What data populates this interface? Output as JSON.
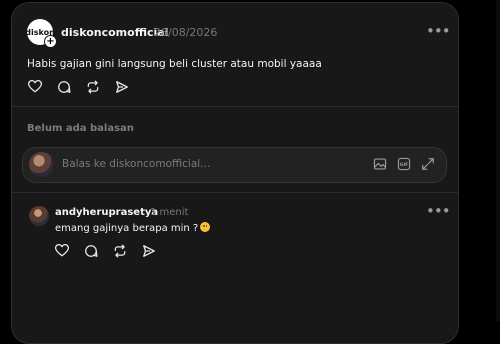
{
  "post": {
    "avatar_text": "diskon",
    "username": "diskoncomofficial",
    "timestamp": "28/08/2026",
    "text": "Habis gajian gini langsung beli cluster atau mobil yaaaa",
    "more_label": "•••"
  },
  "replies_section": {
    "empty_text": "Belum ada balasan"
  },
  "reply_input": {
    "placeholder": "Balas ke diskoncomofficial…"
  },
  "comment": {
    "username": "andyheruprasetya",
    "timestamp": "1 menit",
    "text": "emang gajinya berapa min ?",
    "more_label": "•••"
  },
  "icons": [
    "heart-icon",
    "comment-icon",
    "repost-icon",
    "share-icon",
    "image-icon",
    "gif-icon",
    "expand-icon",
    "more-icon"
  ]
}
